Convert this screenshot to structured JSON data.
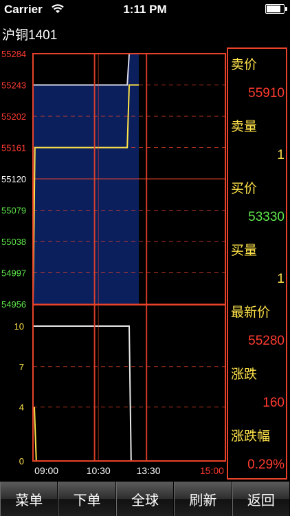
{
  "status_bar": {
    "carrier": "Carrier",
    "time": "1:11 PM",
    "wifi_icon": "wifi-icon",
    "battery_icon": "battery-icon",
    "battery_level": 0.9
  },
  "contract_title": "沪铜1401",
  "colors": {
    "grid": "#e8432a",
    "up": "#ff3b30",
    "down": "#5ee84a",
    "neutral": "#ffffff",
    "price_line": "#ffe34a",
    "fill": "#0b1f5c",
    "label": "#ffe34a",
    "volume": "#ffe34a"
  },
  "chart_data": [
    {
      "type": "line",
      "y_ticks": [
        "55284",
        "55243",
        "55202",
        "55161",
        "55120",
        "55079",
        "55038",
        "54997",
        "54956"
      ],
      "y_tick_colors": [
        "#ff3b30",
        "#ff3b30",
        "#ff3b30",
        "#ff3b30",
        "#ffffff",
        "#5ee84a",
        "#5ee84a",
        "#5ee84a",
        "#5ee84a"
      ],
      "ylim": [
        54956,
        55284
      ],
      "x_ticks": [
        "09:00",
        "10:30",
        "13:30",
        "15:00"
      ],
      "series": [
        {
          "role": "price",
          "points": [
            [
              0,
              54956
            ],
            [
              0.01,
              55161
            ],
            [
              0.49,
              55161
            ],
            [
              0.5,
              55243
            ],
            [
              0.55,
              55243
            ]
          ]
        },
        {
          "role": "average",
          "points": [
            [
              0,
              55243
            ],
            [
              0.49,
              55243
            ],
            [
              0.5,
              55284
            ],
            [
              0.55,
              55284
            ]
          ]
        }
      ]
    },
    {
      "type": "bar",
      "y_ticks": [
        "10",
        "7",
        "4",
        "0"
      ],
      "ylim": [
        0,
        10
      ],
      "series": [
        {
          "role": "volume",
          "points": [
            [
              0,
              4
            ],
            [
              0.01,
              0
            ]
          ]
        },
        {
          "role": "total",
          "points": [
            [
              0,
              10
            ],
            [
              0.5,
              10
            ],
            [
              0.51,
              0
            ],
            [
              0.55,
              0
            ]
          ]
        }
      ]
    }
  ],
  "quote": [
    {
      "label": "卖价",
      "value": "55910",
      "value_color": "#ff3b30"
    },
    {
      "label": "卖量",
      "value": "1",
      "value_color": "#ffe34a"
    },
    {
      "label": "买价",
      "value": "53330",
      "value_color": "#5ee84a"
    },
    {
      "label": "买量",
      "value": "1",
      "value_color": "#ffe34a"
    },
    {
      "label": "最新价",
      "value": "55280",
      "value_color": "#ff3b30"
    },
    {
      "label": "涨跌",
      "value": "160",
      "value_color": "#ff3b30"
    },
    {
      "label": "涨跌幅",
      "value": "0.29%",
      "value_color": "#ff3b30"
    }
  ],
  "toolbar": {
    "menu": "菜单",
    "order": "下单",
    "global": "全球",
    "refresh": "刷新",
    "back": "返回"
  }
}
